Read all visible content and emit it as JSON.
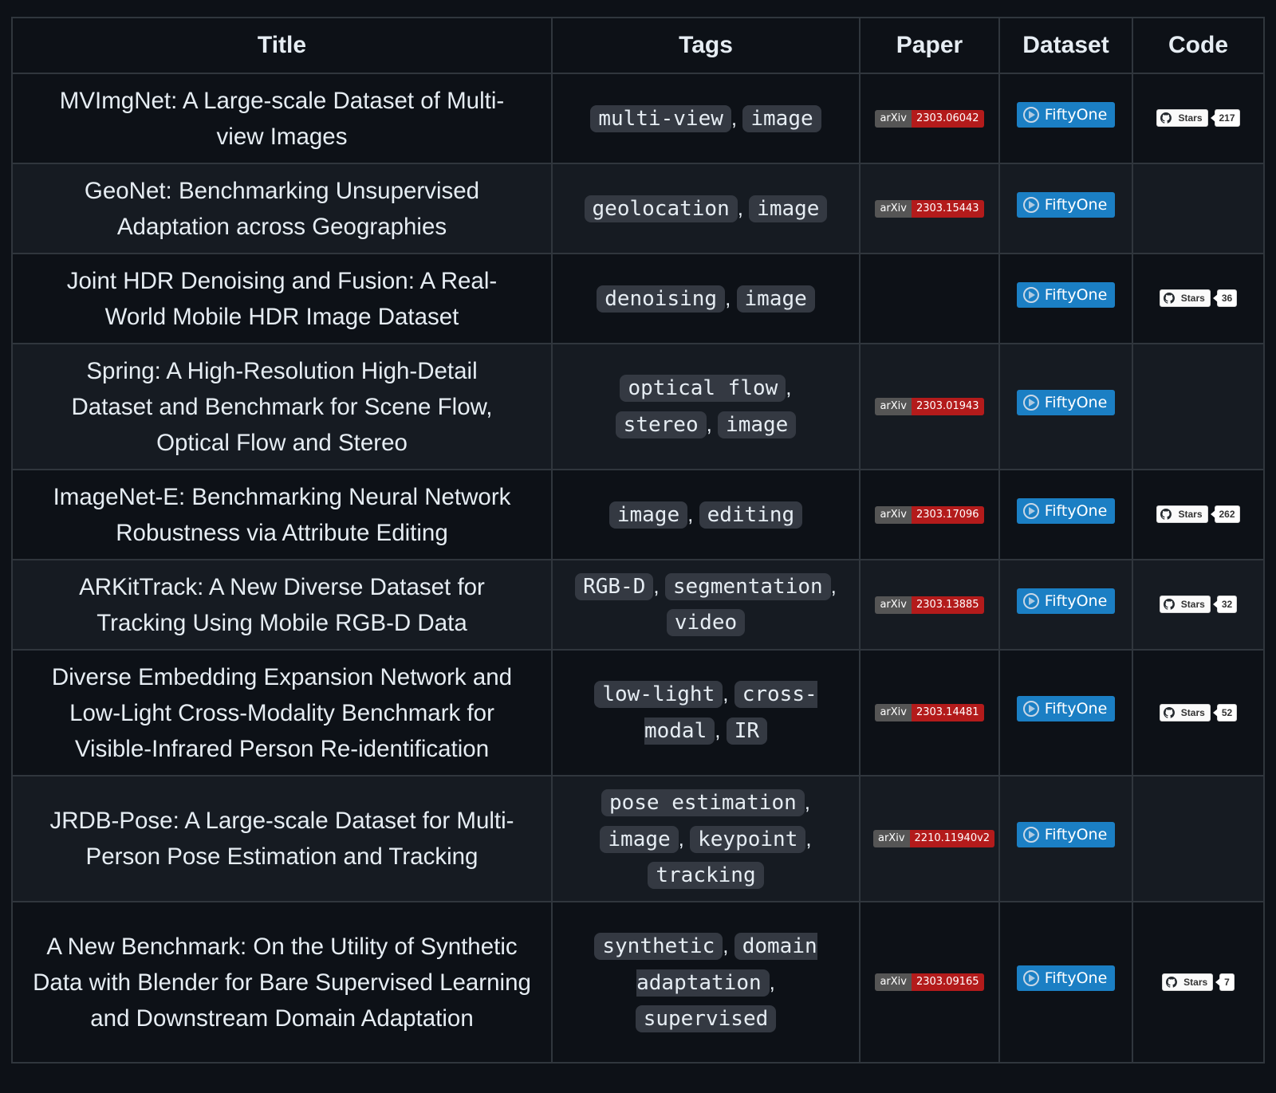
{
  "headers": [
    "Title",
    "Tags",
    "Paper",
    "Dataset",
    "Code"
  ],
  "dataset_label": "FiftyOne",
  "paper_badge_label": "arXiv",
  "stars_label": "Stars",
  "rows": [
    {
      "title": "MVImgNet: A Large-scale Dataset of Multi-view Images",
      "tags": [
        "multi-view",
        "image"
      ],
      "arxiv": "2303.06042",
      "stars": "217"
    },
    {
      "title": "GeoNet: Benchmarking Unsupervised Adaptation across Geographies",
      "tags": [
        "geolocation",
        "image"
      ],
      "arxiv": "2303.15443",
      "stars": null
    },
    {
      "title": "Joint HDR Denoising and Fusion: A Real-World Mobile HDR Image Dataset",
      "tags": [
        "denoising",
        "image"
      ],
      "arxiv": null,
      "stars": "36"
    },
    {
      "title": "Spring: A High-Resolution High-Detail Dataset and Benchmark for Scene Flow, Optical Flow and Stereo",
      "tags": [
        "optical flow",
        "stereo",
        "image"
      ],
      "arxiv": "2303.01943",
      "stars": null
    },
    {
      "title": "ImageNet-E: Benchmarking Neural Network Robustness via Attribute Editing",
      "tags": [
        "image",
        "editing"
      ],
      "arxiv": "2303.17096",
      "stars": "262"
    },
    {
      "title": "ARKitTrack: A New Diverse Dataset for Tracking Using Mobile RGB-D Data",
      "tags": [
        "RGB-D",
        "segmentation",
        "video"
      ],
      "arxiv": "2303.13885",
      "stars": "32"
    },
    {
      "title": "Diverse Embedding Expansion Network and Low-Light Cross-Modality Benchmark for Visible-Infrared Person Re-identification",
      "tags": [
        "low-light",
        "cross-modal",
        "IR"
      ],
      "arxiv": "2303.14481",
      "stars": "52"
    },
    {
      "title": "JRDB-Pose: A Large-scale Dataset for Multi-Person Pose Estimation and Tracking",
      "tags": [
        "pose estimation",
        "image",
        "keypoint",
        "tracking"
      ],
      "arxiv": "2210.11940v2",
      "stars": null
    },
    {
      "title": "A New Benchmark: On the Utility of Synthetic Data with Blender for Bare Supervised Learning and Downstream Domain Adaptation",
      "tags": [
        "synthetic",
        "domain adaptation",
        "supervised"
      ],
      "arxiv": "2303.09165",
      "stars": "7"
    }
  ]
}
